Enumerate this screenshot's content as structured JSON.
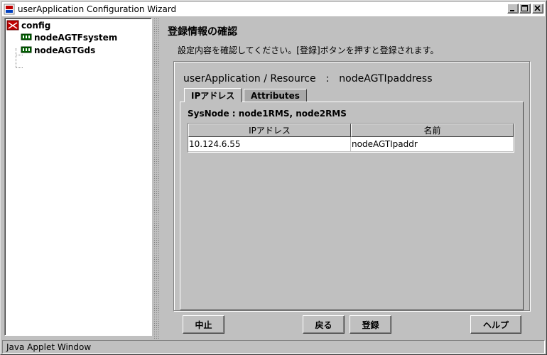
{
  "window": {
    "title": "userApplication Configuration Wizard"
  },
  "tree": {
    "root": "config",
    "children": [
      "nodeAGTFsystem",
      "nodeAGTGds"
    ]
  },
  "main": {
    "title": "登録情報の確認",
    "instruction": "設定内容を確認してください。[登録]ボタンを押すと登録されます。",
    "resource_title": "userApplication / Resource　:　nodeAGTIpaddress",
    "tabs": [
      {
        "label": "IPアドレス",
        "active": true
      },
      {
        "label": "Attributes",
        "active": false
      }
    ],
    "sysnode": "SysNode : node1RMS, node2RMS",
    "table": {
      "headers": [
        "IPアドレス",
        "名前"
      ],
      "rows": [
        [
          "10.124.6.55",
          "nodeAGTIpaddr"
        ]
      ]
    }
  },
  "buttons": {
    "cancel": "中止",
    "back": "戻る",
    "register": "登録",
    "help": "ヘルプ"
  },
  "statusbar": {
    "text": "Java Applet Window"
  },
  "colors": {
    "face": "#c0c0c0",
    "shadow": "#808080",
    "highlight": "#ffffff",
    "dark": "#404040",
    "inactive_tab": "#a8a8a8"
  }
}
